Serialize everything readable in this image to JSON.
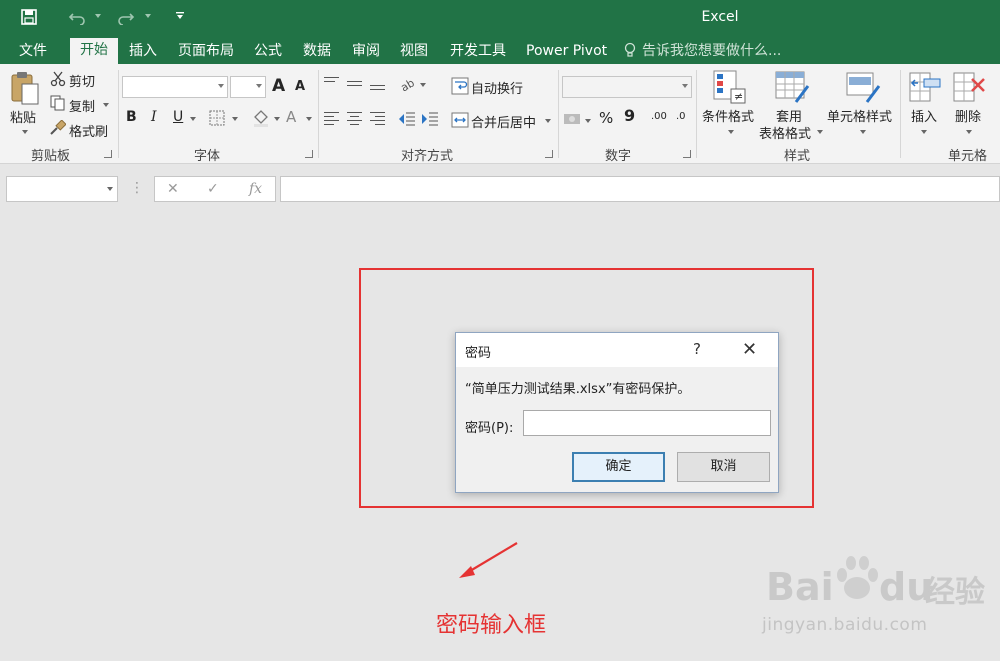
{
  "app": {
    "title": "Excel",
    "brand_color": "#217346"
  },
  "ribbon_tabs": [
    "文件",
    "开始",
    "插入",
    "页面布局",
    "公式",
    "数据",
    "审阅",
    "视图",
    "开发工具",
    "Power Pivot"
  ],
  "active_tab": "开始",
  "tell_me": "告诉我您想要做什么...",
  "clipboard": {
    "paste": "粘贴",
    "cut": "剪切",
    "copy": "复制",
    "format_painter": "格式刷",
    "label": "剪贴板"
  },
  "font": {
    "bold": "B",
    "italic": "I",
    "underline": "U",
    "grow": "A",
    "shrink": "A",
    "font_color": "A",
    "label": "字体"
  },
  "alignment": {
    "wrap_text": "自动换行",
    "merge_center": "合并后居中",
    "label": "对齐方式"
  },
  "number": {
    "percent": "%",
    "comma": "9",
    "inc_decimal": ".00",
    "dec_decimal": ".0",
    "label": "数字"
  },
  "styles": {
    "conditional": "条件格式",
    "table_line1": "套用",
    "table_line2": "表格格式",
    "cell_styles": "单元格样式",
    "label": "样式"
  },
  "cells": {
    "insert": "插入",
    "delete": "删除",
    "label": "单元格"
  },
  "formula_bar": {
    "cancel": "✕",
    "enter": "✓",
    "fx": "fx"
  },
  "dialog": {
    "title": "密码",
    "help": "?",
    "close": "✕",
    "message": "“简单压力测试结果.xlsx”有密码保护。",
    "password_label": "密码(P):",
    "password_value": "",
    "ok": "确定",
    "cancel": "取消"
  },
  "annotation": {
    "text": "密码输入框",
    "color": "#e53333"
  },
  "watermark": {
    "logo": "Bai",
    "logo2": "du",
    "logo3": "经验",
    "url": "jingyan.baidu.com"
  }
}
